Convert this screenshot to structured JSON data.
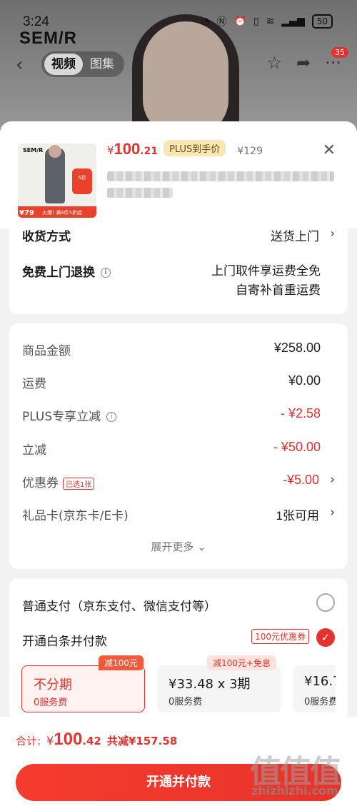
{
  "status_bar": {
    "time": "3:24",
    "battery": "50"
  },
  "product_page": {
    "brand": "SEM/R",
    "media_tabs": [
      "视频",
      "图集"
    ],
    "cart_count": "35"
  },
  "sheet": {
    "thumbnail": {
      "brand": "SEM/R",
      "price": "¥79",
      "promo": "火爆! 满4件5折起",
      "badge": "5折"
    },
    "price": {
      "symbol": "¥",
      "integer": "100",
      "decimal": ".21"
    },
    "plus_tag": "PLUS到手价",
    "original_price": "¥129",
    "delivery": {
      "method_label": "收货方式",
      "method_value": "送货上门",
      "return_label": "免费上门退换",
      "return_line1": "上门取件享运费全免",
      "return_line2": "自寄补首重运费"
    },
    "fees": {
      "goods_label": "商品金额",
      "goods_value": "¥258.00",
      "shipping_label": "运费",
      "shipping_value": "¥0.00",
      "plus_label": "PLUS专享立减",
      "plus_value": "- ¥2.58",
      "instant_label": "立减",
      "instant_value": "- ¥50.00",
      "coupon_label": "优惠券",
      "coupon_tag": "已选1张",
      "coupon_value": "-¥5.00",
      "giftcard_label": "礼品卡(京东卡/E卡)",
      "giftcard_value": "1张可用",
      "expand_more": "展开更多"
    },
    "payment": {
      "normal_label": "普通支付（京东支付、微信支付等）",
      "baitiao_label": "开通白条并付款",
      "baitiao_coupon": "100元优惠券",
      "plans": [
        {
          "tag": "减100元",
          "title": "不分期",
          "sub": "0服务费"
        },
        {
          "tag": "减100元+免息",
          "title": "¥33.48 x 3期",
          "sub": "0服务费"
        },
        {
          "tag": "",
          "title": "¥16.7",
          "sub": "0服务费"
        }
      ]
    }
  },
  "footer": {
    "total_label": "合计:",
    "total_symbol": "¥",
    "total_integer": "100",
    "total_decimal": ".42",
    "total_saved": "共减¥157.58",
    "cta": "开通并付款"
  },
  "watermark": {
    "main": "值值值",
    "url": "zhizhizhi.com"
  },
  "colors": {
    "accent": "#e5322d",
    "plus_tag_bg": "#fbe6b5",
    "page_bg": "#f2f2f2"
  }
}
